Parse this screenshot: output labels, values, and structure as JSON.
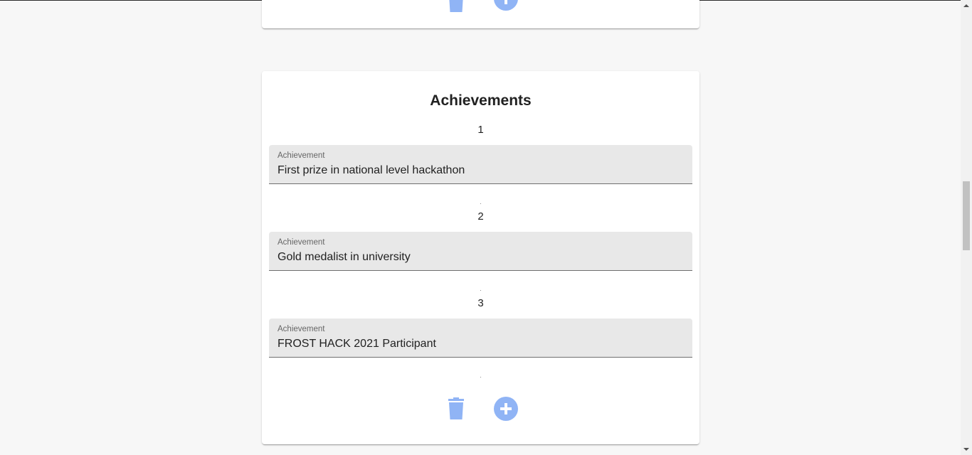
{
  "section": {
    "title": "Achievements",
    "field_label": "Achievement",
    "entries": [
      {
        "number": "1",
        "value": "First prize in national level hackathon",
        "separator": "."
      },
      {
        "number": "2",
        "value": "Gold medalist in university",
        "separator": "."
      },
      {
        "number": "3",
        "value": "FROST HACK 2021 Participant",
        "separator": "."
      }
    ]
  },
  "icons": {
    "delete": "trash-icon",
    "add": "plus-circle-icon",
    "accent": "#90b4f5"
  }
}
